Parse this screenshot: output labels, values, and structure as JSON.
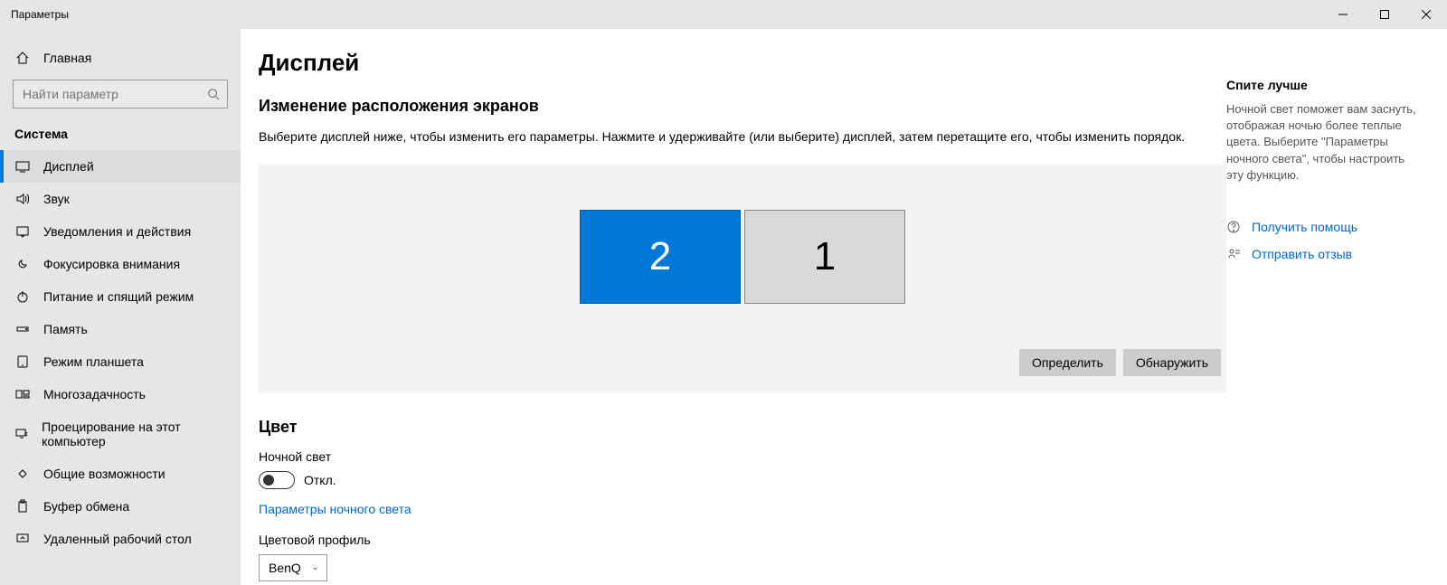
{
  "window": {
    "title": "Параметры"
  },
  "sidebar": {
    "home": "Главная",
    "search_placeholder": "Найти параметр",
    "section": "Система",
    "items": [
      {
        "icon": "display",
        "label": "Дисплей",
        "active": true
      },
      {
        "icon": "sound",
        "label": "Звук"
      },
      {
        "icon": "notifications",
        "label": "Уведомления и действия"
      },
      {
        "icon": "focus",
        "label": "Фокусировка внимания"
      },
      {
        "icon": "power",
        "label": "Питание и спящий режим"
      },
      {
        "icon": "storage",
        "label": "Память"
      },
      {
        "icon": "tablet",
        "label": "Режим планшета"
      },
      {
        "icon": "multitask",
        "label": "Многозадачность"
      },
      {
        "icon": "project",
        "label": "Проецирование на этот компьютер"
      },
      {
        "icon": "shared",
        "label": "Общие возможности"
      },
      {
        "icon": "clipboard",
        "label": "Буфер обмена"
      },
      {
        "icon": "remote",
        "label": "Удаленный рабочий стол"
      }
    ]
  },
  "main": {
    "title": "Дисплей",
    "arrange_h": "Изменение расположения экранов",
    "arrange_desc": "Выберите дисплей ниже, чтобы изменить его параметры. Нажмите и удерживайте (или выберите) дисплей, затем перетащите его, чтобы изменить порядок.",
    "monitor_selected": "2",
    "monitor_other": "1",
    "btn_identify": "Определить",
    "btn_detect": "Обнаружить",
    "color_h": "Цвет",
    "night_light_label": "Ночной свет",
    "toggle_off": "Откл.",
    "night_light_settings_link": "Параметры ночного света",
    "color_profile_label": "Цветовой профиль",
    "color_profile_value": "BenQ"
  },
  "right": {
    "sleep_h": "Спите лучше",
    "sleep_p": "Ночной свет поможет вам заснуть, отображая ночью более теплые цвета. Выберите \"Параметры ночного света\", чтобы настроить эту функцию.",
    "help": "Получить помощь",
    "feedback": "Отправить отзыв"
  }
}
